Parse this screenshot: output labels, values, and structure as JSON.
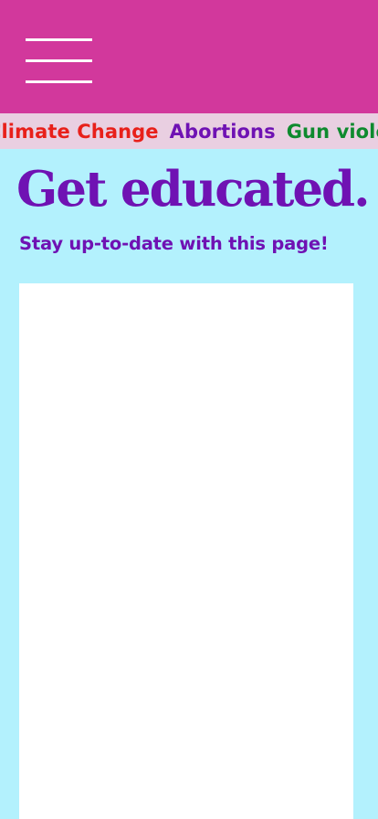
{
  "header": {
    "menu_icon": "hamburger-menu-icon",
    "background_color": "#d2389c"
  },
  "ticker": {
    "items": [
      {
        "label": "Climate Change",
        "color": "#e8201a"
      },
      {
        "label": "Abortions",
        "color": "#6f12b3"
      },
      {
        "label": "Gun violence",
        "color": "#0e8a2e"
      }
    ]
  },
  "main": {
    "title": "Get educated.",
    "subtitle": "Stay up-to-date with this page!",
    "text_color": "#6f12b3",
    "background_color": "#b3f1fd"
  }
}
